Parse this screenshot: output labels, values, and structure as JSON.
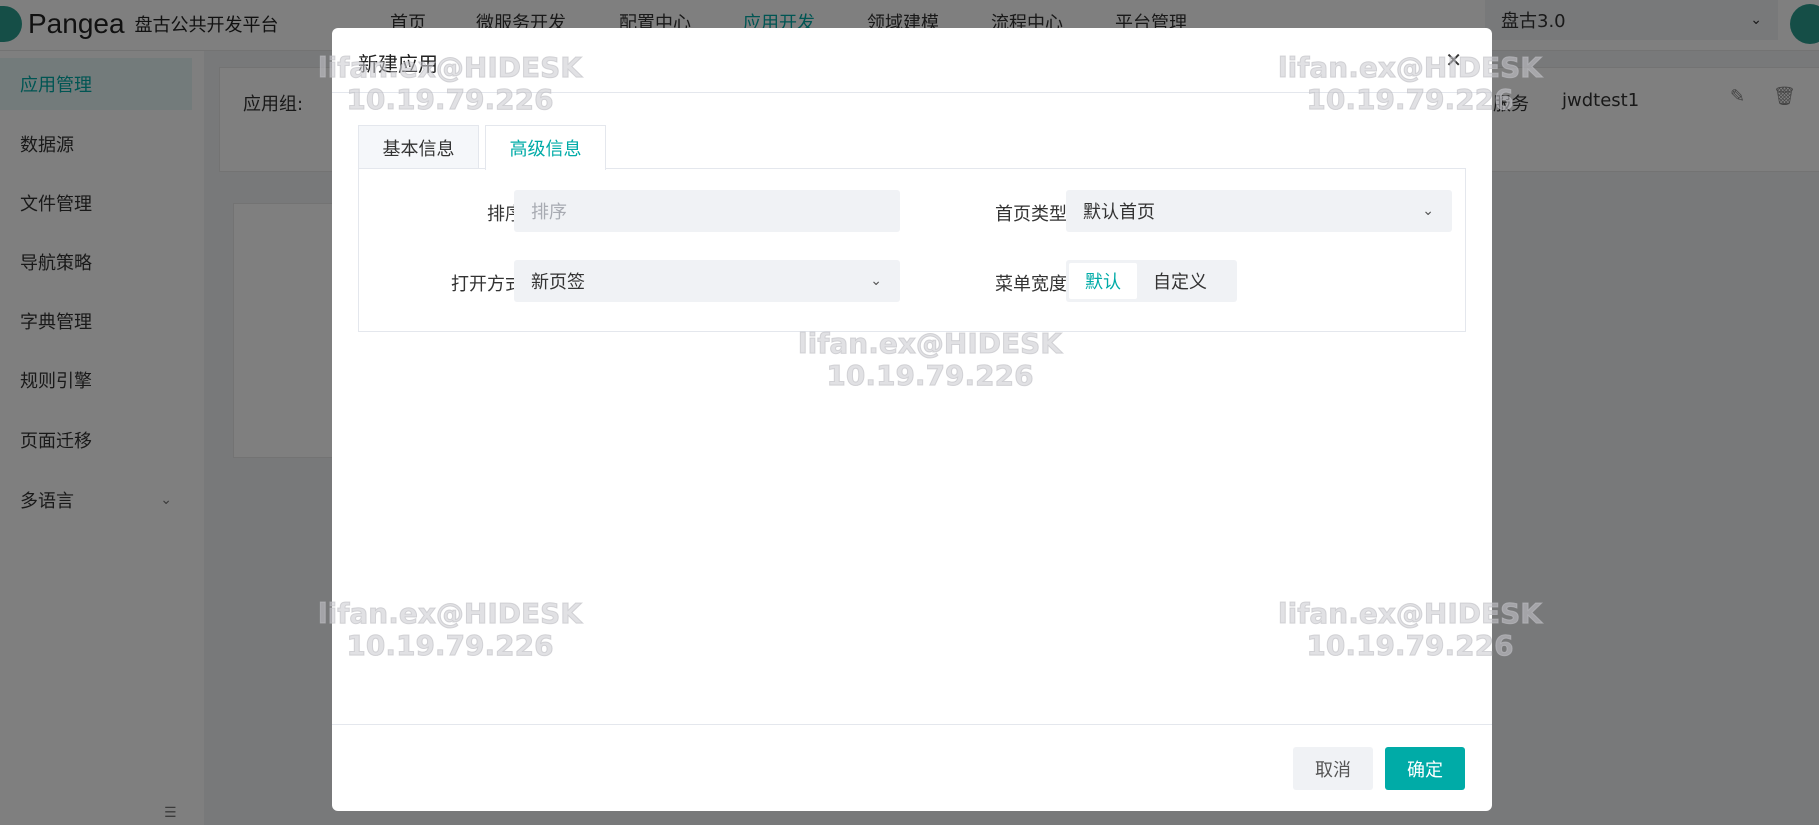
{
  "header": {
    "logo_text": "Pangea",
    "platform_name": "盘古公共开发平台",
    "nav": [
      "首页",
      "微服务开发",
      "配置中心",
      "应用开发",
      "领域建模",
      "流程中心",
      "平台管理"
    ],
    "active_nav": "应用开发",
    "version_select": "盘古3.0"
  },
  "sidebar": {
    "items": [
      "应用管理",
      "数据源",
      "文件管理",
      "导航策略",
      "字典管理",
      "规则引擎",
      "页面迁移",
      "多语言"
    ],
    "active": "应用管理"
  },
  "background": {
    "app_group_label": "应用组:",
    "service_label": "服务",
    "service_value": "jwdtest1"
  },
  "dialog": {
    "title": "新建应用",
    "tabs": [
      "基本信息",
      "高级信息"
    ],
    "active_tab": "高级信息",
    "form": {
      "sort_label": "排序",
      "sort_placeholder": "排序",
      "open_mode_label": "打开方式",
      "open_mode_value": "新页签",
      "home_type_label": "首页类型",
      "home_type_value": "默认首页",
      "menu_width_label": "菜单宽度",
      "menu_width_options": [
        "默认",
        "自定义"
      ],
      "menu_width_selected": "默认"
    },
    "cancel_label": "取消",
    "confirm_label": "确定"
  },
  "watermark": {
    "user": "lifan.ex@HIDESK",
    "ip": "10.19.79.226"
  },
  "colors": {
    "accent": "#00aba7",
    "overlay": "rgba(0,0,0,0.5)"
  }
}
